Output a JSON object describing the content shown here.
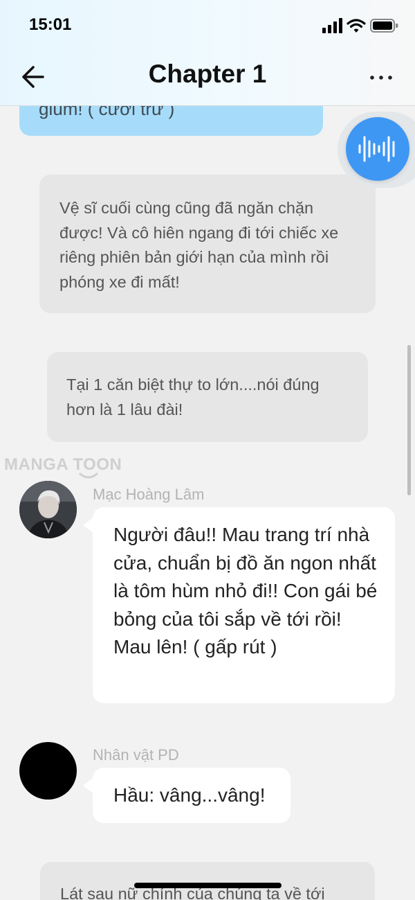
{
  "status_bar": {
    "time": "15:01"
  },
  "header": {
    "title": "Chapter 1"
  },
  "messages": {
    "top_bubble": "giùm! ( cười trừ )",
    "narration_1": "Vệ sĩ cuối cùng cũng đã ngăn chặn được! Và cô hiên ngang đi tới chiếc xe riêng phiên bản giới hạn của mình rồi phóng xe đi mất!",
    "narration_2": "Tại 1 căn biệt thự to lớn....nói đúng hơn là 1 lâu đài!",
    "speaker_1": {
      "name": "Mạc Hoàng Lâm",
      "text": "Người đâu!! Mau trang trí nhà cửa, chuẩn bị đồ ăn ngon nhất là tôm hùm nhỏ đi!! Con gái bé bỏng của tôi sắp về tới rồi! Mau lên! ( gấp rút )"
    },
    "speaker_2": {
      "name": "Nhân vật PD",
      "text": "Hầu: vâng...vâng!"
    },
    "narration_3": "Lát sau nữ chính của chúng ta về tới"
  },
  "watermark": "MANGA TOON",
  "icons": {
    "back": "back-arrow-icon",
    "more": "more-dots-icon",
    "voice": "voice-waveform-icon",
    "signal": "cellular-signal-icon",
    "wifi": "wifi-icon",
    "battery": "battery-icon"
  },
  "colors": {
    "voice_button": "#3f97f4",
    "top_bubble": "#a6dcfa",
    "narration_bg": "#e6e6e6",
    "page_bg": "#f2f2f2"
  }
}
